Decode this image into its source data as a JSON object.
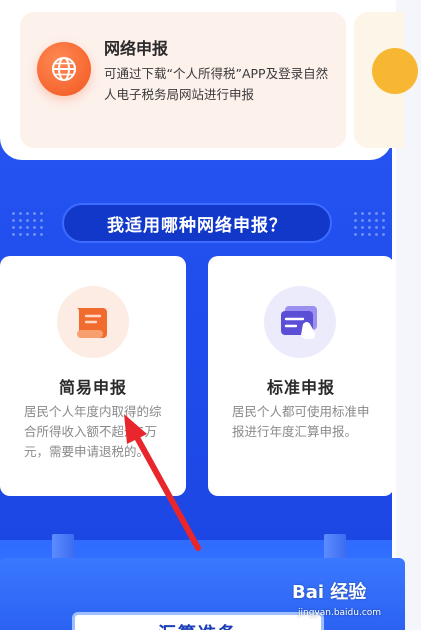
{
  "online_option": {
    "title": "网络申报",
    "description": "可通过下载“个人所得税”APP及登录自然人电子税务局网站进行申报"
  },
  "section": {
    "question": "我适用哪种网络申报？"
  },
  "methods": [
    {
      "title": "简易申报",
      "description": "居民个人年度内取得的综合所得收入额不超过6万元，需要申请退税的。"
    },
    {
      "title": "标准申报",
      "description": "居民个人都可使用标准申报进行年度汇算申报。"
    }
  ],
  "bottom_button": {
    "label": "汇算准备"
  },
  "watermark": {
    "logo_text": "Bai 经验",
    "url_text": "jingyan.baidu.com"
  },
  "colors": {
    "primary_blue": "#1d46e8",
    "accent_orange": "#f2561f",
    "accent_purple": "#6a5ae0",
    "arrow_red": "#e8262c"
  },
  "icons": {
    "online_option": "globe-icon",
    "simple": "scroll-document-icon",
    "standard": "card-tap-icon"
  }
}
